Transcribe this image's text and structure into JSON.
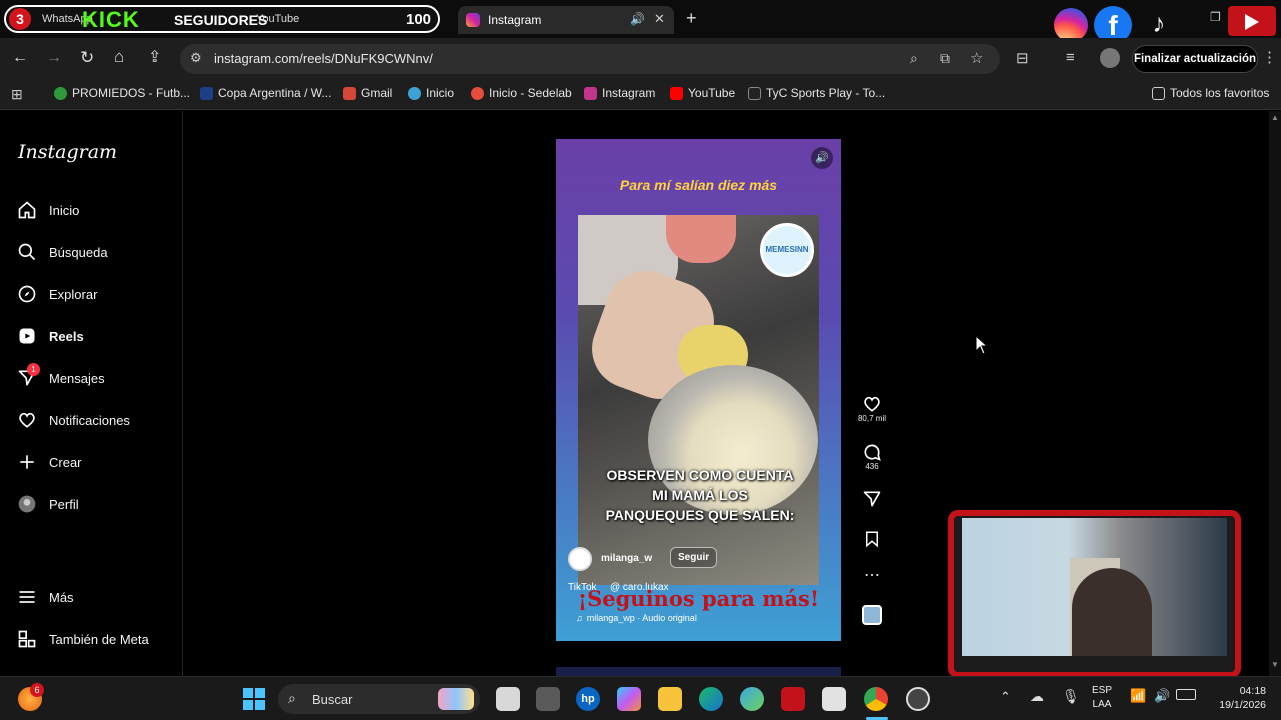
{
  "tabs": [
    {
      "label": "WhatsApp",
      "badge": "3",
      "overlay_kick": "KICK",
      "overlay_seguidores": "SEGUIDORES",
      "overlay_count": "100",
      "second_label": "YouTube"
    },
    {
      "label": "Instagram"
    }
  ],
  "toolbar": {
    "url": "instagram.com/reels/DNuFK9CWNnv/",
    "update_button": "Finalizar actualización"
  },
  "bookmarks": [
    {
      "label": "PROMIEDOS - Futb...",
      "color": "#2e9a3c"
    },
    {
      "label": "Copa Argentina / W...",
      "color": "#1d3f8a"
    },
    {
      "label": "Gmail",
      "color": "#d44638"
    },
    {
      "label": "Inicio",
      "color": "#3fa2d6"
    },
    {
      "label": "Inicio - Sedelab",
      "color": "#e84c3d"
    },
    {
      "label": "Instagram",
      "color": "#c1358c"
    },
    {
      "label": "YouTube",
      "color": "#ff0000"
    },
    {
      "label": "TyC Sports Play - To...",
      "color": "#222222"
    }
  ],
  "bookmarks_all": "Todos los favoritos",
  "instagram": {
    "logo": "Instagram",
    "nav": [
      {
        "label": "Inicio",
        "icon": "home-icon"
      },
      {
        "label": "Búsqueda",
        "icon": "search-icon"
      },
      {
        "label": "Explorar",
        "icon": "compass-icon"
      },
      {
        "label": "Reels",
        "icon": "reels-icon"
      },
      {
        "label": "Mensajes",
        "icon": "messages-icon",
        "badge": "1"
      },
      {
        "label": "Notificaciones",
        "icon": "heart-icon"
      },
      {
        "label": "Crear",
        "icon": "plus-icon"
      },
      {
        "label": "Perfil",
        "icon": "profile-icon"
      }
    ],
    "more": "Más",
    "meta": "También de Meta"
  },
  "reel": {
    "top_caption": "Para mí salían diez más",
    "watermark": "MEMESINN",
    "video_caption": "OBSERVEN COMO CUENTA MI MAMÁ LOS PANQUEQUES QUE SALEN:",
    "username": "milanga_w",
    "follow": "Seguir",
    "tiktok": "TikTok",
    "tiktok_user": "@ caro.lukax",
    "banner": "¡Seguinos para más!",
    "audio": "milanga_wp · Audio original",
    "likes": "80,7 mil",
    "comments": "436"
  },
  "taskbar": {
    "search": "Buscar",
    "notif_badge": "6",
    "lang_top": "ESP",
    "lang_bottom": "LAA",
    "time": "04:18",
    "date": "19/1/2026"
  },
  "colors": {
    "accent_red": "#c4121a",
    "ig_badge": "#ff3040"
  }
}
